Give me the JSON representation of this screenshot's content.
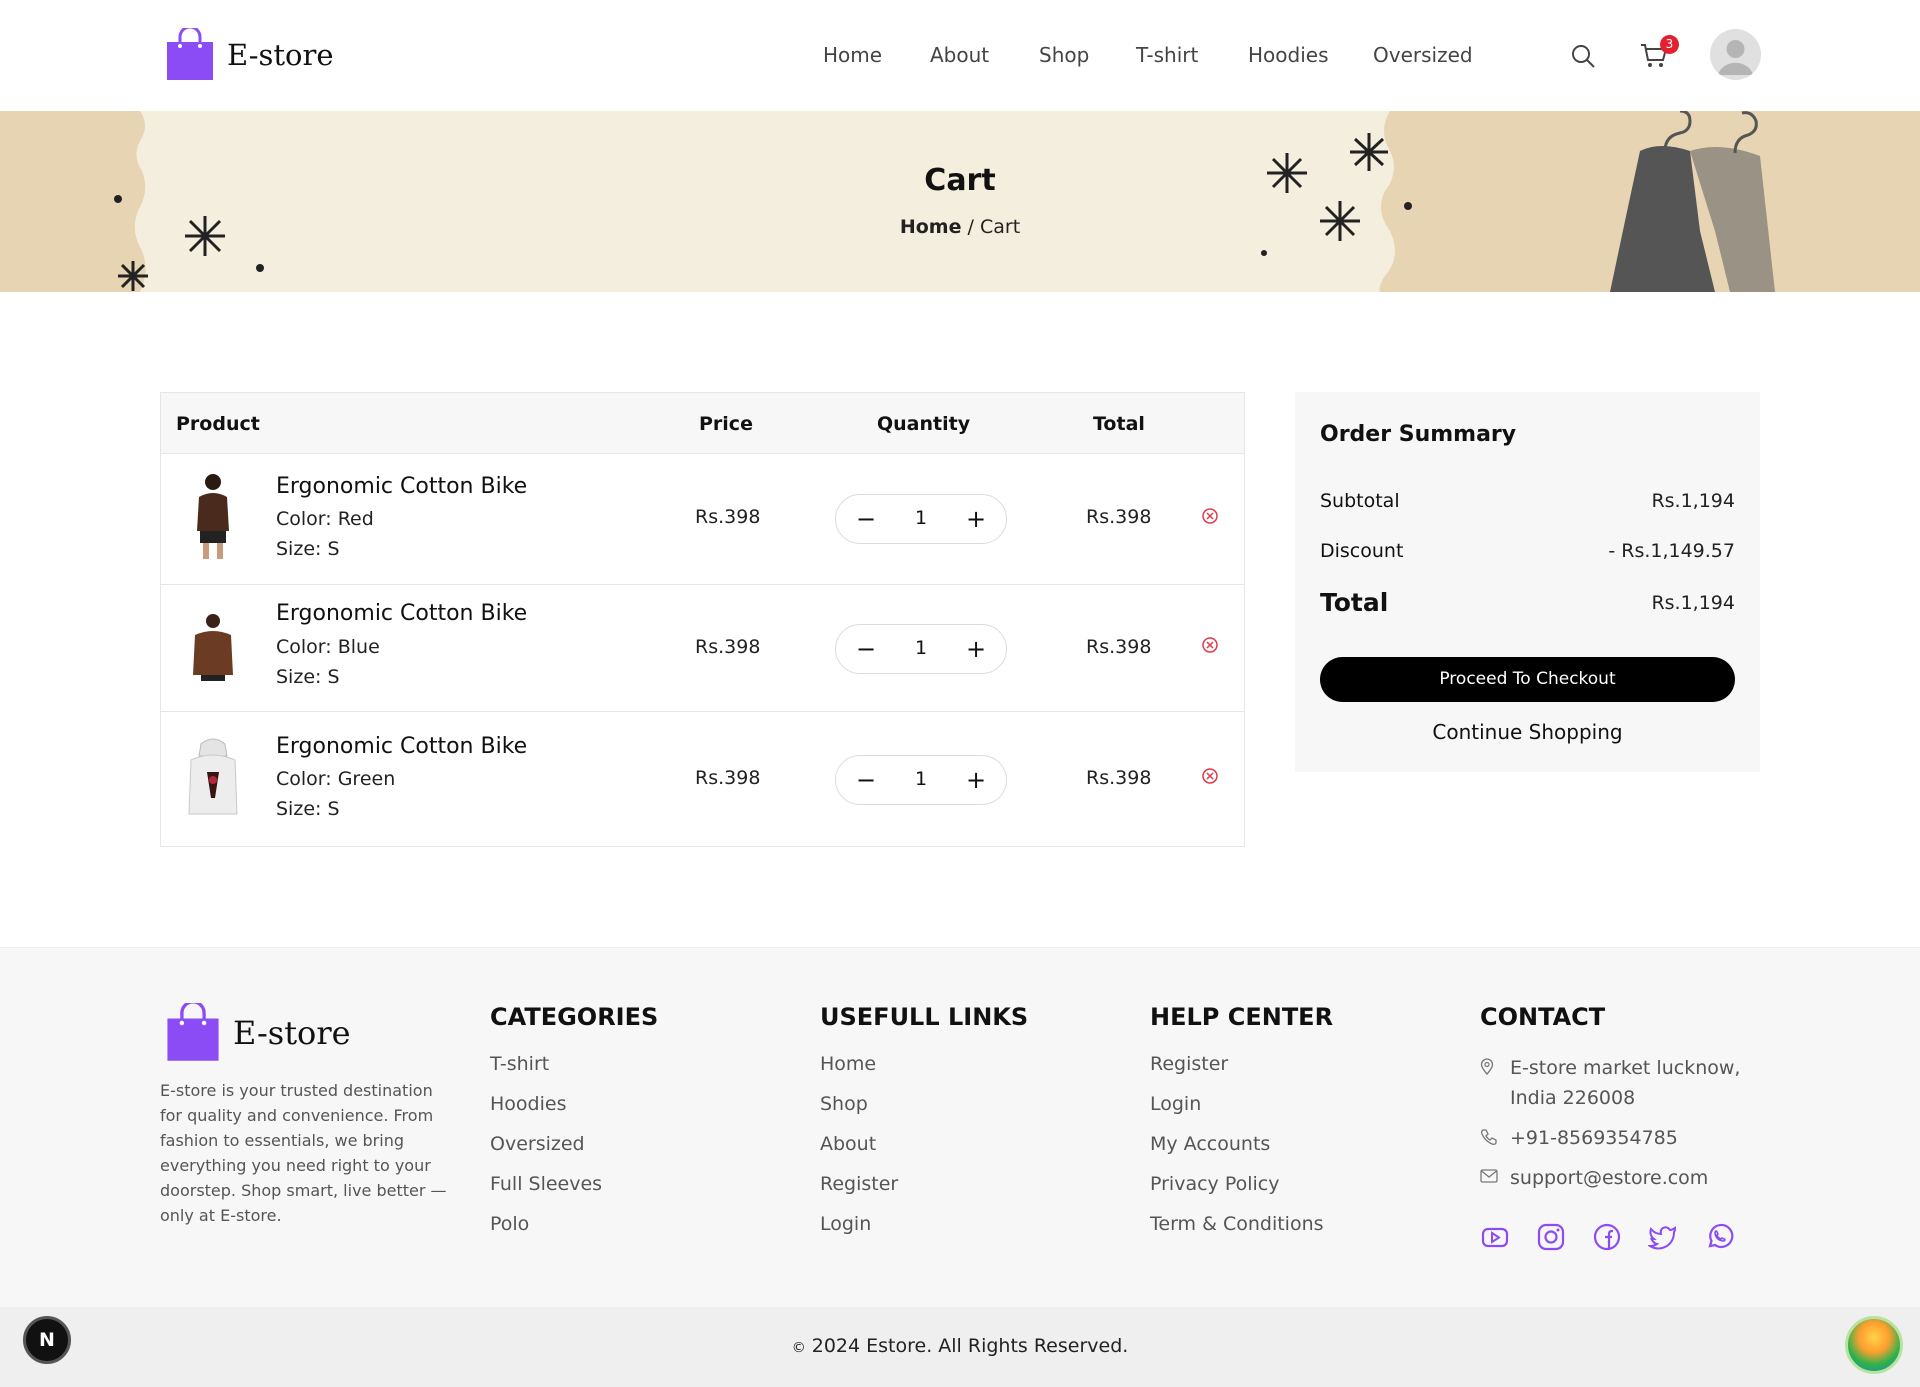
{
  "header": {
    "brand": "E-store",
    "nav": [
      "Home",
      "About",
      "Shop",
      "T-shirt",
      "Hoodies",
      "Oversized"
    ],
    "cart_count": "3"
  },
  "banner": {
    "title": "Cart",
    "breadcrumb_home": "Home",
    "breadcrumb_current": "/ Cart"
  },
  "table": {
    "headers": {
      "product": "Product",
      "price": "Price",
      "quantity": "Quantity",
      "total": "Total"
    },
    "rows": [
      {
        "name": "Ergonomic Cotton Bike",
        "color": "Color: Red",
        "size": "Size: S",
        "price": "Rs.398",
        "qty": "1",
        "total": "Rs.398"
      },
      {
        "name": "Ergonomic Cotton Bike",
        "color": "Color: Blue",
        "size": "Size: S",
        "price": "Rs.398",
        "qty": "1",
        "total": "Rs.398"
      },
      {
        "name": "Ergonomic Cotton Bike",
        "color": "Color: Green",
        "size": "Size: S",
        "price": "Rs.398",
        "qty": "1",
        "total": "Rs.398"
      }
    ]
  },
  "summary": {
    "title": "Order Summary",
    "subtotal_label": "Subtotal",
    "subtotal": "Rs.1,194",
    "discount_label": "Discount",
    "discount": "- Rs.1,149.57",
    "total_label": "Total",
    "total": "Rs.1,194",
    "checkout": "Proceed To Checkout",
    "continue": "Continue Shopping"
  },
  "footer": {
    "brand": "E-store",
    "description": "E-store is your trusted destination for quality and convenience. From fashion to essentials, we bring everything you need right to your doorstep. Shop smart, live better — only at E-store.",
    "categories": {
      "title": "CATEGORIES",
      "items": [
        "T-shirt",
        "Hoodies",
        "Oversized",
        "Full Sleeves",
        "Polo"
      ]
    },
    "links": {
      "title": "USEFULL LINKS",
      "items": [
        "Home",
        "Shop",
        "About",
        "Register",
        "Login"
      ]
    },
    "help": {
      "title": "HELP CENTER",
      "items": [
        "Register",
        "Login",
        "My Accounts",
        "Privacy Policy",
        "Term & Conditions"
      ]
    },
    "contact": {
      "title": "CONTACT",
      "address": "E-store market lucknow, India 226008",
      "phone": "+91-8569354785",
      "email": "support@estore.com"
    },
    "copyright": "2024 Estore. All Rights Reserved.",
    "copyright_symbol": "©"
  },
  "colors": {
    "accent": "#8b4cf5",
    "remove": "#e03a4a",
    "badge": "#e3202f"
  },
  "icons": [
    "search-icon",
    "cart-icon",
    "avatar",
    "remove-icon",
    "location-icon",
    "phone-icon",
    "mail-icon",
    "youtube-icon",
    "instagram-icon",
    "facebook-icon",
    "twitter-icon",
    "whatsapp-icon"
  ],
  "misc": {
    "n_button": "N"
  }
}
